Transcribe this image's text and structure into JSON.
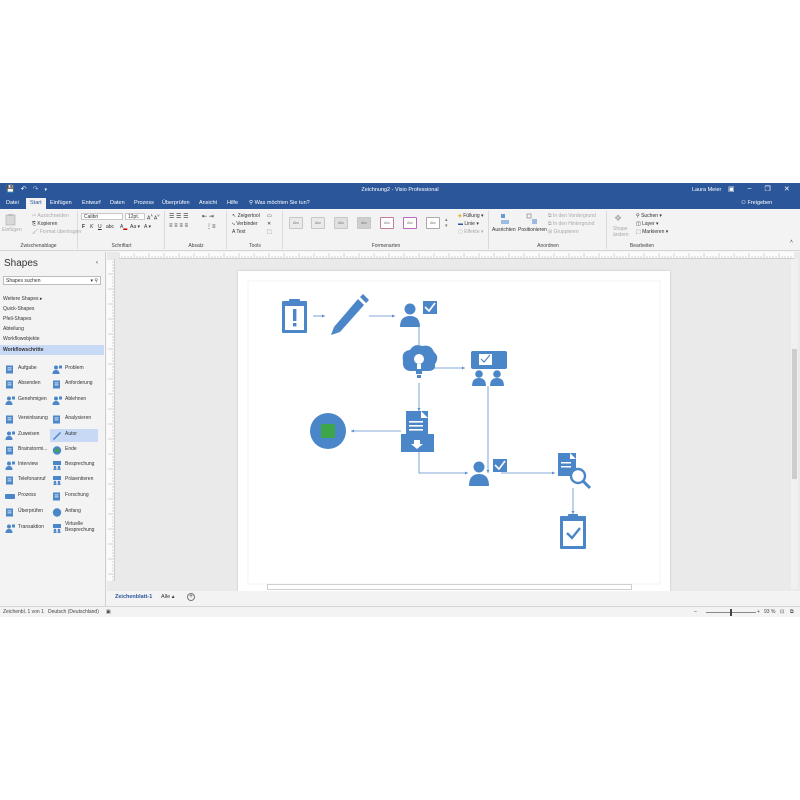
{
  "app": {
    "window_title": "Zeichnung2 - Visio Professional",
    "user": "Laura Meier",
    "share_label": "Freigeben",
    "tell_me": "Was möchten Sie tun?"
  },
  "ribbon_tabs": [
    "Datei",
    "Start",
    "Einfügen",
    "Entwurf",
    "Daten",
    "Prozess",
    "Überprüfen",
    "Ansicht",
    "Hilfe"
  ],
  "ribbon": {
    "clipboard": {
      "paste": "Einfügen",
      "cut": "Ausschneiden",
      "copy": "Kopieren",
      "format_painter": "Format übertragen",
      "label": "Zwischenablage"
    },
    "font": {
      "family": "Calibri",
      "size": "12pt.",
      "label": "Schriftart"
    },
    "paragraph": {
      "label": "Absatz"
    },
    "tools": {
      "pointer": "Zeigertool",
      "connector": "Verbinder",
      "text": "Text",
      "label": "Tools"
    },
    "shape_styles": {
      "boxes": [
        "Abc",
        "Abc",
        "Abc",
        "Abc",
        "Abc",
        "Abc",
        "Abc"
      ],
      "fill": "Füllung",
      "line": "Linie",
      "effects": "Effekte",
      "label": "Formenarten"
    },
    "arrange": {
      "align": "Ausrichten",
      "position": "Positionieren",
      "bring_front": "In den Vordergrund",
      "send_back": "In den Hintergrund",
      "group": "Gruppieren",
      "label": "Anordnen"
    },
    "editing": {
      "change_shape_1": "Shape",
      "change_shape_2": "ändern",
      "find": "Suchen",
      "layer": "Layer",
      "select": "Markieren",
      "label": "Bearbeiten"
    }
  },
  "shapes_pane": {
    "title": "Shapes",
    "search_placeholder": "Shapes suchen",
    "stencils": [
      "Weitere Shapes",
      "Quick-Shapes",
      "Pfeil-Shapes",
      "Abteilung",
      "Workflowobjekte",
      "Workflowschritte"
    ],
    "shapes": [
      {
        "label": "Aufgabe",
        "icon": "clipboard-alert-icon"
      },
      {
        "label": "Problem",
        "icon": "person-icon"
      },
      {
        "label": "Absenden",
        "icon": "send-icon"
      },
      {
        "label": "Anforderung",
        "icon": "request-icon"
      },
      {
        "label": "Genehmigen",
        "icon": "approve-icon"
      },
      {
        "label": "Ablehnen",
        "icon": "reject-icon"
      },
      {
        "label": "Vereinbarung",
        "icon": "agreement-icon"
      },
      {
        "label": "Analysieren",
        "icon": "analyze-icon"
      },
      {
        "label": "Zuweisen",
        "icon": "assign-icon"
      },
      {
        "label": "Autor",
        "icon": "pencil-icon"
      },
      {
        "label": "Brainstormi...",
        "icon": "brainstorm-icon"
      },
      {
        "label": "Ende",
        "icon": "end-icon"
      },
      {
        "label": "Interview",
        "icon": "interview-icon"
      },
      {
        "label": "Besprechung",
        "icon": "meeting-icon"
      },
      {
        "label": "Telefonanruf",
        "icon": "phone-icon"
      },
      {
        "label": "Präsentieren",
        "icon": "present-icon"
      },
      {
        "label": "Prozess",
        "icon": "process-icon"
      },
      {
        "label": "Forschung",
        "icon": "research-icon"
      },
      {
        "label": "Überprüfen",
        "icon": "review-icon"
      },
      {
        "label": "Anfang",
        "icon": "start-icon"
      },
      {
        "label": "Transaktion",
        "icon": "transaction-icon"
      },
      {
        "label": "Virtuelle Besprechung",
        "icon": "virtual-meeting-icon"
      }
    ]
  },
  "sheet_tabs": {
    "active": "Zeichenblatt-1",
    "all": "Alle"
  },
  "status": {
    "page": "Zeichenbl. 1 von 1",
    "language": "Deutsch (Deutschland)",
    "zoom": "93 %"
  },
  "colors": {
    "title_bar": "#2b579a",
    "shape_blue": "#4a86c8",
    "start_green": "#3da64a"
  }
}
